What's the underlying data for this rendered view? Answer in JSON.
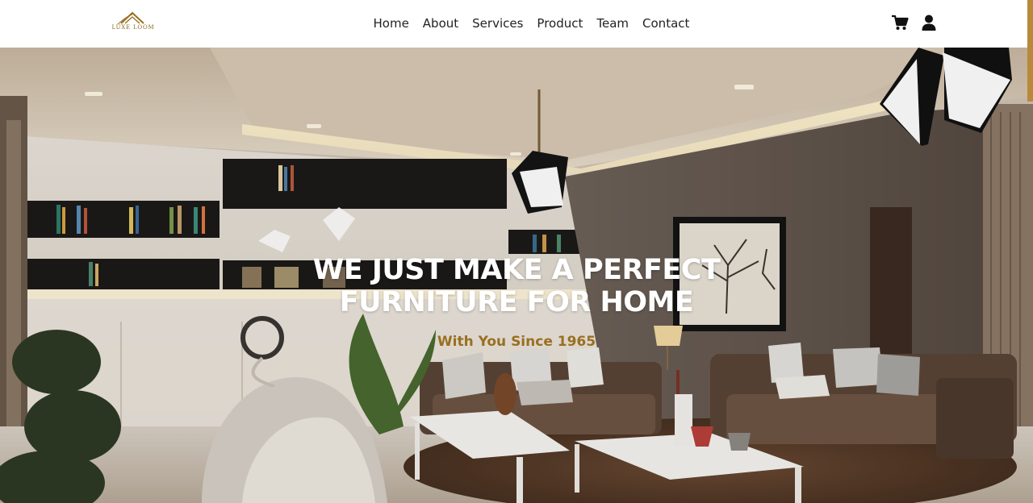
{
  "brand": {
    "name": "LUXE LOOM",
    "accent_color": "#9a6f20"
  },
  "nav": {
    "items": [
      {
        "label": "Home"
      },
      {
        "label": "About"
      },
      {
        "label": "Services"
      },
      {
        "label": "Product"
      },
      {
        "label": "Team"
      },
      {
        "label": "Contact"
      }
    ]
  },
  "header_icons": {
    "cart": "cart-icon",
    "account": "user-icon"
  },
  "hero": {
    "headline_line1": "WE JUST MAKE A PERFECT",
    "headline_line2": "FURNITURE FOR HOME",
    "tagline": "With You Since 1965",
    "image": "living-room-interior"
  }
}
